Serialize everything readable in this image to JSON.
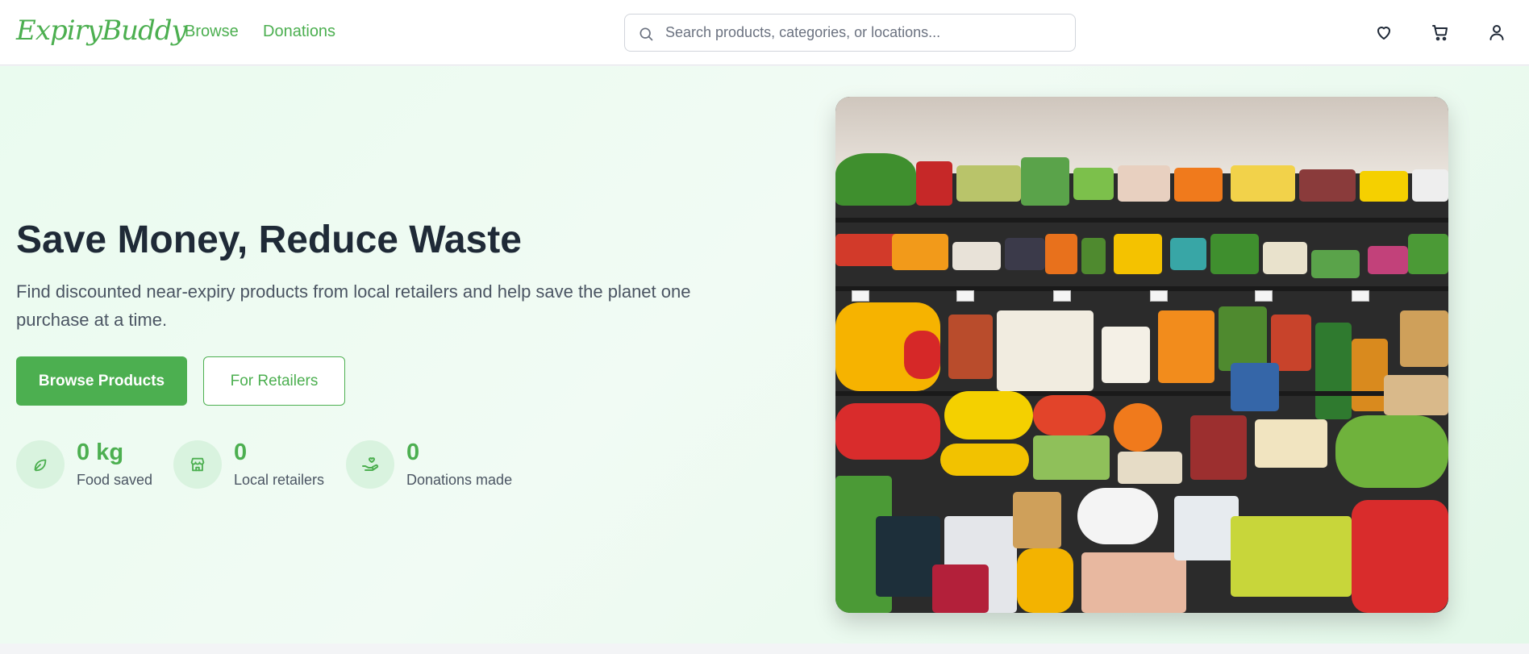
{
  "header": {
    "logo": "ExpiryBuddy",
    "nav": {
      "browse": "Browse",
      "donations": "Donations"
    },
    "search_placeholder": "Search products, categories, or locations...",
    "icons": [
      "heart-icon",
      "cart-icon",
      "user-icon"
    ]
  },
  "hero": {
    "title": "Save Money, Reduce Waste",
    "subtitle": "Find discounted near-expiry products from local retailers and help save the planet one purchase at a time.",
    "buttons": {
      "primary": "Browse Products",
      "secondary": "For Retailers"
    },
    "stats": [
      {
        "value": "0 kg",
        "label": "Food saved",
        "icon": "leaf-icon"
      },
      {
        "value": "0",
        "label": "Local retailers",
        "icon": "store-icon"
      },
      {
        "value": "0",
        "label": "Donations made",
        "icon": "donation-hand-icon"
      }
    ]
  },
  "colors": {
    "accent": "#4caf50",
    "hero_bg": "#eafbef",
    "title": "#1f2a37",
    "text": "#4b5563"
  }
}
